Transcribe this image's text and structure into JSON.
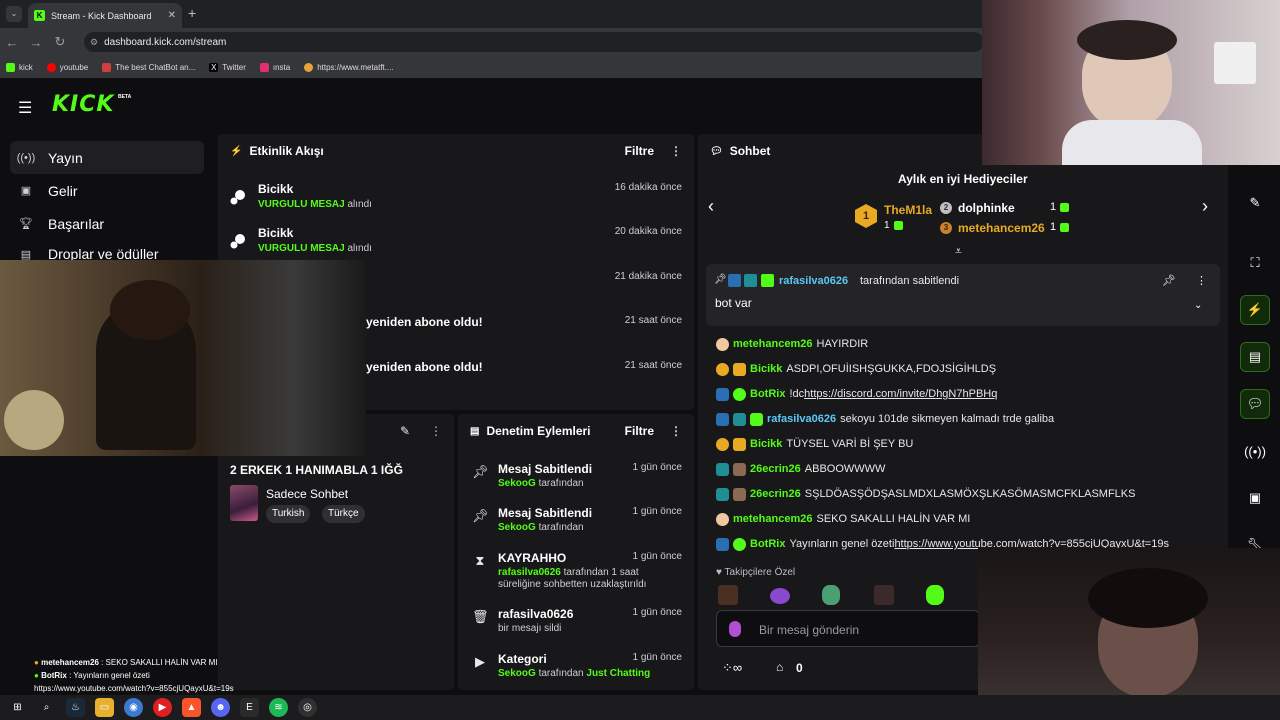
{
  "browser": {
    "tab_title": "Stream - Kick Dashboard",
    "url": "dashboard.kick.com/stream",
    "bookmarks": [
      {
        "label": "kick",
        "color": "#53fc18"
      },
      {
        "label": "youtube",
        "color": "#ff0000"
      },
      {
        "label": "The best ChatBot an...",
        "color": "#d04040"
      },
      {
        "label": "Twitter",
        "color": "#ffffff"
      },
      {
        "label": "ınsta",
        "color": "#e1306c"
      },
      {
        "label": "https://www.metatft....",
        "color": "#e6a23c"
      }
    ]
  },
  "brand": {
    "logo": "KICK",
    "badge": "BETA"
  },
  "sidebar": {
    "items": [
      {
        "label": "Yayın",
        "icon": "broadcast-icon"
      },
      {
        "label": "Gelir",
        "icon": "revenue-icon"
      },
      {
        "label": "Başarılar",
        "icon": "trophy-icon"
      },
      {
        "label": "Droplar ve ödüller",
        "icon": "gift-icon"
      }
    ]
  },
  "activity": {
    "title": "Etkinlik Akışı",
    "filter": "Filtre",
    "events": [
      {
        "name": "Bicikk",
        "highlight": "VURGULU MESAJ",
        "rest": " alındı",
        "time": "16 dakika önce"
      },
      {
        "name": "Bicikk",
        "highlight": "VURGULU MESAJ",
        "rest": " alındı",
        "time": "20 dakika önce"
      },
      {
        "name": "",
        "highlight": "",
        "rest": "",
        "time": "21 dakika önce"
      },
      {
        "name": "yeniden abone oldu!",
        "highlight": "",
        "rest": "",
        "time": "21 saat önce"
      },
      {
        "name": "yeniden abone oldu!",
        "highlight": "",
        "rest": "",
        "time": "21 saat önce"
      }
    ]
  },
  "stream_info": {
    "title": "2 ERKEK 1 HANIMABLA 1 IĞĞ",
    "category": "Sadece Sohbet",
    "tags": [
      "Turkish",
      "Türkçe"
    ]
  },
  "moderation": {
    "title": "Denetim Eylemleri",
    "filter": "Filtre",
    "items": [
      {
        "icon": "pin-icon",
        "t1": "Mesaj Sabitlendi",
        "actor": "SekooG",
        "rest": " tarafından",
        "time": "1 gün önce"
      },
      {
        "icon": "pin-icon",
        "t1": "Mesaj Sabitlendi",
        "actor": "SekooG",
        "rest": " tarafından",
        "time": "1 gün önce"
      },
      {
        "icon": "hourglass-icon",
        "t1": "KAYRAHHO",
        "actor": "rafasilva0626",
        "rest": " tarafından 1 saat süreliğine sohbetten uzaklaştırıldı",
        "time": "1 gün önce"
      },
      {
        "icon": "trash-icon",
        "t1": "rafasilva0626",
        "actor": "",
        "rest": "bir mesajı sildi",
        "time": "1 gün önce"
      },
      {
        "icon": "category-icon",
        "t1": "Kategori",
        "actor": "SekooG",
        "rest": " tarafından ",
        "extra": "Just Chatting",
        "time": "1 gün önce"
      }
    ]
  },
  "chat": {
    "title": "Sohbet",
    "gifters_title": "Aylık en iyi Hediyeciler",
    "gifters": [
      {
        "rank": "1",
        "name": "TheM1la",
        "count": "1"
      },
      {
        "rank": "2",
        "name": "dolphinke",
        "count": "1"
      },
      {
        "rank": "3",
        "name": "metehancem26",
        "count": "1"
      }
    ],
    "pinned_by": "rafasilva0626",
    "pinned_suffix": "tarafından sabitlendi",
    "pinned_text": "bot var",
    "messages": [
      {
        "user": "metehancem26",
        "color": "#53fc18",
        "text": "HAYIRDIR",
        "link": ""
      },
      {
        "user": "Bicikk",
        "color": "#53fc18",
        "text": "ASDPI,OFUİISHŞGUKKA,FDOJSİGİHLDŞ",
        "link": ""
      },
      {
        "user": "BotRix",
        "color": "#53fc18",
        "text": "!dc ",
        "link": "https://discord.com/invite/DhgN7hPBHq"
      },
      {
        "user": "rafasilva0626",
        "color": "#5bc8f5",
        "text": "sekoyu 101de sikmeyen kalmadı trde galiba",
        "link": ""
      },
      {
        "user": "Bicikk",
        "color": "#53fc18",
        "text": "TÜYSEL VARİ Bİ ŞEY BU",
        "link": ""
      },
      {
        "user": "26ecrin26",
        "color": "#53fc18",
        "text": "ABBOOWWWW",
        "link": ""
      },
      {
        "user": "26ecrin26",
        "color": "#53fc18",
        "text": "SŞLDÖASŞÖDŞASLMDXLASMÖXŞLKASÖMASMCFKLASMFLKS",
        "link": ""
      },
      {
        "user": "metehancem26",
        "color": "#53fc18",
        "text": "SEKO SAKALLI HALİN VAR MI",
        "link": ""
      },
      {
        "user": "BotRix",
        "color": "#53fc18",
        "text": "Yayınların genel özeti ",
        "link": "https://www.youtube.com/watch?v=855cjUQayxU&t=19s"
      }
    ],
    "followers_only": "Takipçilere Özel",
    "input_placeholder": "Bir mesaj gönderin",
    "viewer_count": "0"
  },
  "overlay_chat": {
    "l1_user": "metehancem26",
    "l1_text": " : SEKO SAKALLI HALİN VAR MI",
    "l2_user": "BotRix",
    "l2_text": " : Yayınların genel özeti",
    "l3_text": "https://www.youtube.com/watch?v=855cjUQayxU&t=19s"
  },
  "colors": {
    "brand": "#53fc18",
    "panel": "#18181b",
    "bg": "#0e0e10"
  }
}
